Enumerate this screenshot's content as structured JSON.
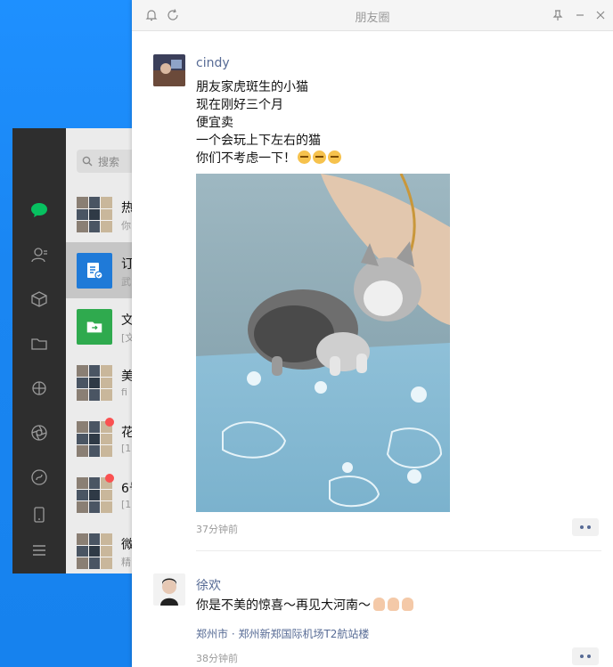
{
  "wechat": {
    "search_placeholder": "搜索",
    "chats": [
      {
        "name": "热",
        "preview": "你"
      },
      {
        "name": "订",
        "preview": "武"
      },
      {
        "name": "文",
        "preview": "[文"
      },
      {
        "name": "美",
        "preview": "fi"
      },
      {
        "name": "花",
        "preview": "[1"
      },
      {
        "name": "6号",
        "preview": "[1"
      },
      {
        "name": "微",
        "preview": "精"
      }
    ]
  },
  "moments": {
    "title": "朋友圈",
    "posts": [
      {
        "user": "cindy",
        "lines": [
          "朋友家虎斑生的小猫",
          "现在刚好三个月",
          "便宜卖",
          "一个会玩上下左右的猫",
          "你们不考虑一下！"
        ],
        "time": "37分钟前"
      },
      {
        "user": "徐欢",
        "text": "你是不美的惊喜～再见大河南～",
        "location": "郑州市 · 郑州新郑国际机场T2航站楼",
        "time": "38分钟前"
      }
    ]
  },
  "colors": {
    "accent_link": "#576b95",
    "wechat_green": "#07c160",
    "desktop_blue": "#1a86f2"
  }
}
